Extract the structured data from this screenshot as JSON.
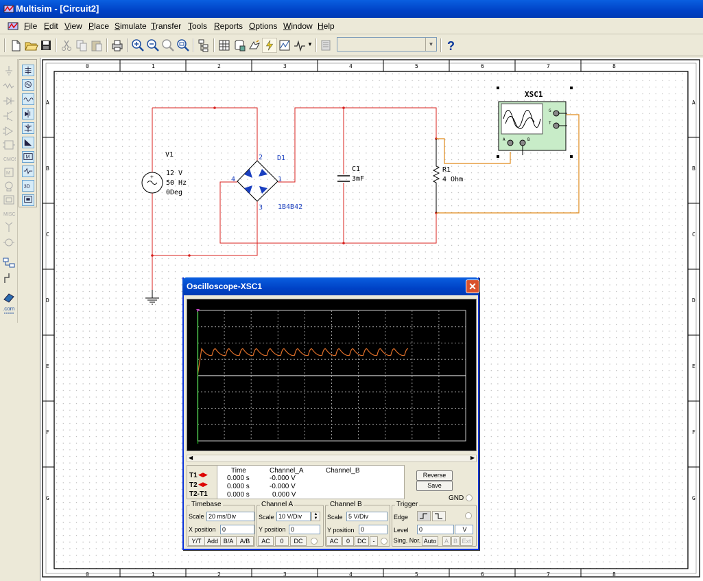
{
  "window": {
    "title": "Multisim - [Circuit2]"
  },
  "menu": [
    "File",
    "Edit",
    "View",
    "Place",
    "Simulate",
    "Transfer",
    "Tools",
    "Reports",
    "Options",
    "Window",
    "Help"
  ],
  "menu_mnemonics": [
    "F",
    "E",
    "V",
    "P",
    "S",
    "T",
    "T",
    "R",
    "O",
    "W",
    "H"
  ],
  "toolbar_icons": [
    "new-icon",
    "open-icon",
    "save-icon",
    "cut-icon",
    "copy-icon",
    "paste-icon",
    "print-icon",
    "zoom-in-icon",
    "zoom-out-icon",
    "zoom-area-icon",
    "zoom-fit-icon",
    "hierarchy-icon",
    "spreadsheet-icon",
    "database-icon",
    "component-wizard-icon",
    "simulate-icon",
    "grapher-icon",
    "postprocessor-icon",
    "instruments-icon",
    "help-icon"
  ],
  "in_use_list": {
    "value": ""
  },
  "sheet": {
    "col_labels": [
      "0",
      "1",
      "2",
      "3",
      "4",
      "5",
      "6",
      "7",
      "8"
    ],
    "row_labels": [
      "A",
      "B",
      "C",
      "D",
      "E",
      "F",
      "G"
    ]
  },
  "components": {
    "v1": {
      "ref": "V1",
      "voltage": "12 V",
      "freq": "50 Hz",
      "phase": "0Deg"
    },
    "d1": {
      "ref": "D1",
      "model": "1B4B42",
      "pin1": "1",
      "pin2": "2",
      "pin3": "3",
      "pin4": "4"
    },
    "c1": {
      "ref": "C1",
      "value": "3mF"
    },
    "r1": {
      "ref": "R1",
      "value": "4 Ohm"
    },
    "xsc1": {
      "ref": "XSC1",
      "pin_g": "G",
      "pin_t": "T",
      "pin_a": "A",
      "pin_b": "B"
    }
  },
  "scope": {
    "title": "Oscilloscope-XSC1",
    "close": "✕",
    "cursor_headers": {
      "time": "Time",
      "cha": "Channel_A",
      "chb": "Channel_B"
    },
    "rows": [
      {
        "label": "T1",
        "time": "0.000 s",
        "cha": "-0.000 V",
        "chb": ""
      },
      {
        "label": "T2",
        "time": "0.000 s",
        "cha": "-0.000 V",
        "chb": ""
      },
      {
        "label": "T2-T1",
        "time": "0.000 s",
        "cha": "0.000 V",
        "chb": ""
      }
    ],
    "reverse": "Reverse",
    "save": "Save",
    "gnd": "GND",
    "timebase": {
      "title": "Timebase",
      "scale_label": "Scale",
      "scale": "20 ms/Div",
      "xpos_label": "X position",
      "xpos": "0",
      "yt": "Y/T",
      "add": "Add",
      "ba": "B/A",
      "ab": "A/B"
    },
    "channel_a": {
      "title": "Channel A",
      "scale_label": "Scale",
      "scale": "10  V/Div",
      "ypos_label": "Y position",
      "ypos": "0",
      "ac": "AC",
      "zero": "0",
      "dc": "DC"
    },
    "channel_b": {
      "title": "Channel B",
      "scale_label": "Scale",
      "scale": "5  V/Div",
      "ypos_label": "Y position",
      "ypos": "0",
      "ac": "AC",
      "zero": "0",
      "dc": "DC",
      "minus": "-"
    },
    "trigger": {
      "title": "Trigger",
      "edge_label": "Edge",
      "level_label": "Level",
      "level": "0",
      "level_unit": "V",
      "sing": "Sing.",
      "nor": "Nor.",
      "auto": "Auto",
      "a": "A",
      "b": "B",
      "ext": "Ext"
    }
  },
  "chart_data": {
    "type": "line",
    "series": [
      {
        "ripple_min_v": 12.5,
        "ripple_max_v": 16.5,
        "cycles": 15
      }
    ],
    "x_divs": 10,
    "y_divs": 8,
    "ylim": [
      -40,
      40
    ]
  }
}
